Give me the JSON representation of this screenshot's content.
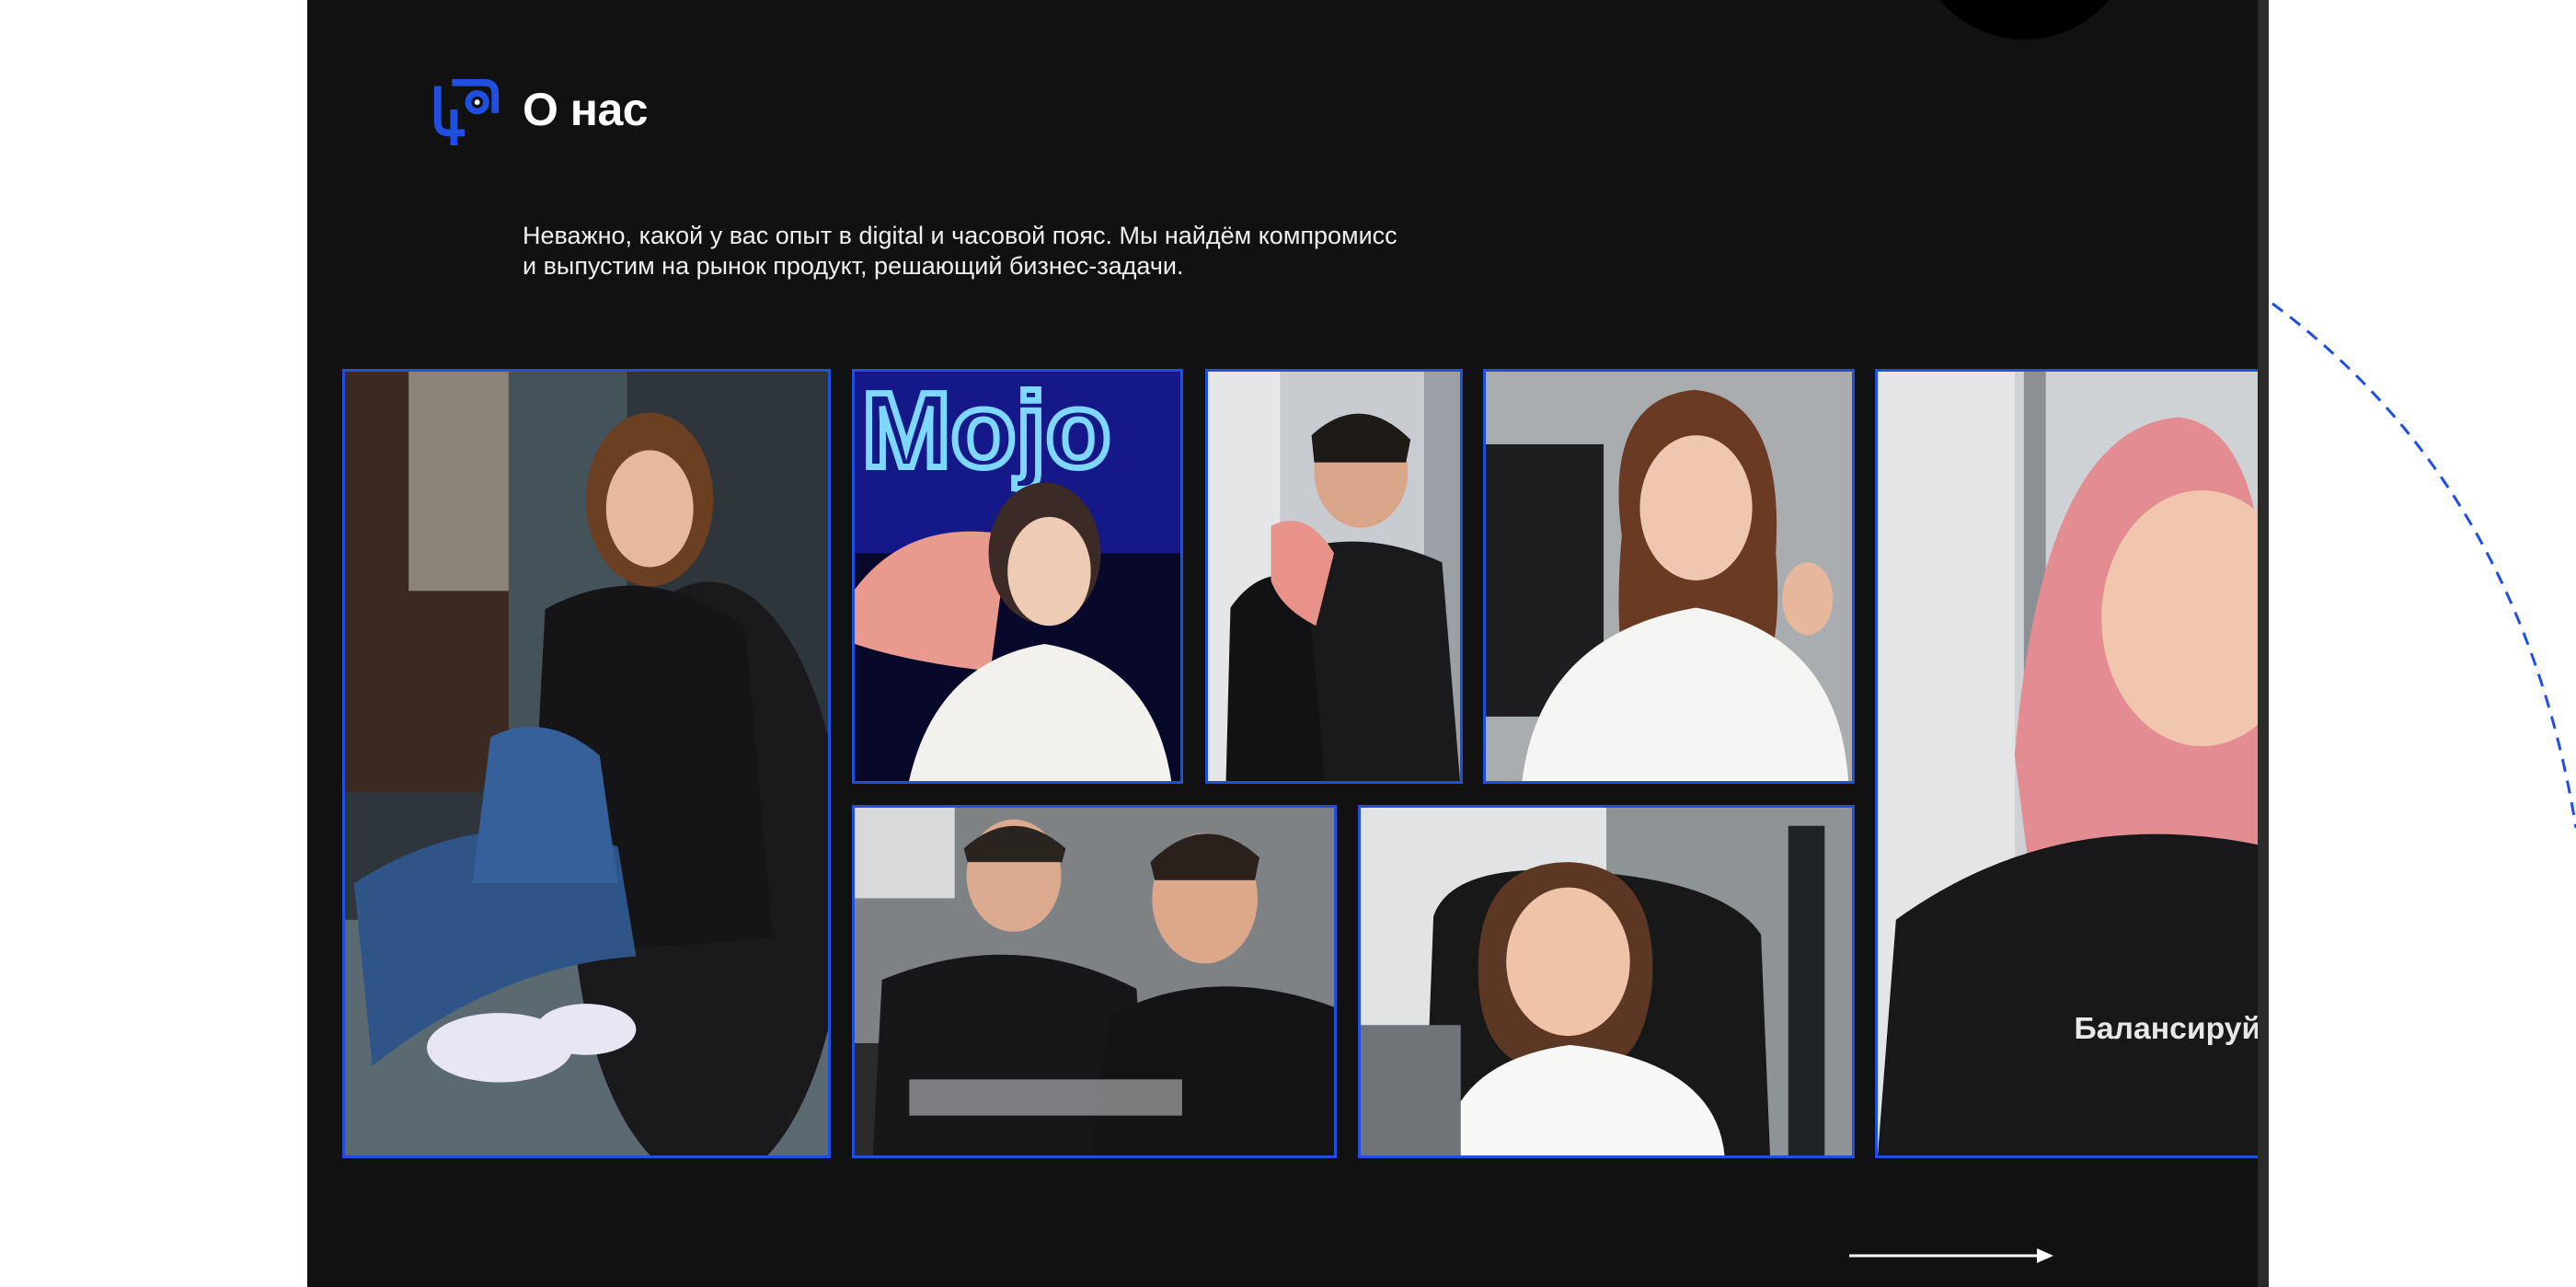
{
  "section": {
    "title": "О нас",
    "description_lines": [
      "Неважно, какой у вас опыт в digital и часовой пояс. Мы найдём компромисс",
      "и выпустим на рынок продукт, решающий бизнес-задачи."
    ]
  },
  "photos": {
    "neon_sign_text": "Mojo",
    "hoodie_text": "Балансируй"
  },
  "colors": {
    "panel_bg": "#111111",
    "accent_blue": "#1f4fe0",
    "text": "#ffffff"
  },
  "icons": [
    "brand-logo-icon",
    "arrow-right-icon"
  ]
}
